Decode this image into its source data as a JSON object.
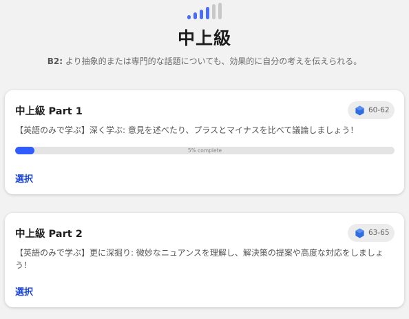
{
  "header": {
    "level_icon": "signal-bars-icon",
    "title": "中上級",
    "subtitle_code": "B2:",
    "subtitle_text": " より抽象的または専門的な話題についても、効果的に自分の考えを伝えられる。"
  },
  "colors": {
    "bar_active": "#4a6cf7",
    "bar_inactive": "#c8c8c8",
    "accent": "#2f5bff",
    "link": "#1a45d6"
  },
  "cards": [
    {
      "title": "中上級 Part 1",
      "badge_icon": "hexagon-gem-icon",
      "badge": "60-62",
      "description": "【英語のみで学ぶ】深く学ぶ: 意見を述べたり、プラスとマイナスを比べて議論しましょう！",
      "progress_fraction": 0.05,
      "progress_label": "5% complete",
      "action": "選択"
    },
    {
      "title": "中上級 Part 2",
      "badge_icon": "hexagon-gem-icon",
      "badge": "63-65",
      "description": "【英語のみで学ぶ】更に深掘り: 微妙なニュアンスを理解し、解決策の提案や高度な対応をしましょう！",
      "action": "選択"
    }
  ]
}
